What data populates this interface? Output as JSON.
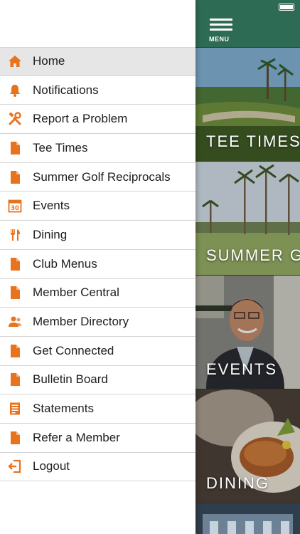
{
  "drawer": {
    "items": [
      {
        "label": "Home",
        "icon": "home-icon",
        "active": true
      },
      {
        "label": "Notifications",
        "icon": "bell-icon"
      },
      {
        "label": "Report a Problem",
        "icon": "tools-icon"
      },
      {
        "label": "Tee Times",
        "icon": "document-icon"
      },
      {
        "label": "Summer Golf Reciprocals",
        "icon": "document-icon"
      },
      {
        "label": "Events",
        "icon": "calendar-icon"
      },
      {
        "label": "Dining",
        "icon": "utensils-icon"
      },
      {
        "label": "Club Menus",
        "icon": "document-icon"
      },
      {
        "label": "Member Central",
        "icon": "document-icon"
      },
      {
        "label": "Member Directory",
        "icon": "people-icon"
      },
      {
        "label": "Get Connected",
        "icon": "document-icon"
      },
      {
        "label": "Bulletin Board",
        "icon": "document-icon"
      },
      {
        "label": "Statements",
        "icon": "statement-icon"
      },
      {
        "label": "Refer a Member",
        "icon": "document-icon"
      },
      {
        "label": "Logout",
        "icon": "logout-icon"
      }
    ],
    "calendar_day": "30"
  },
  "header": {
    "menu_label": "MENU"
  },
  "tiles": [
    {
      "label": "TEE TIMES"
    },
    {
      "label": "SUMMER GOLF"
    },
    {
      "label": "EVENTS"
    },
    {
      "label": "DINING"
    }
  ],
  "colors": {
    "accent": "#e8731f",
    "header": "#2e6b55",
    "active_row": "#e6e6e6"
  }
}
